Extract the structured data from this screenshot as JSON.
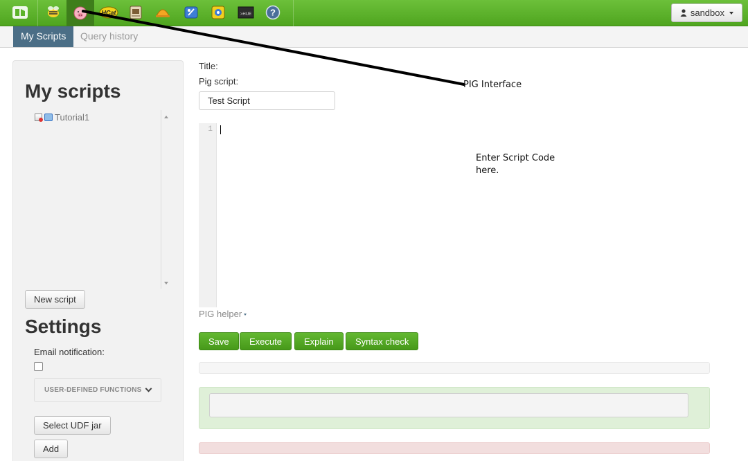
{
  "topbar": {
    "apps": [
      {
        "name": "hortonworks-logo-icon"
      },
      {
        "name": "beeswax-hive-icon"
      },
      {
        "name": "pig-icon"
      },
      {
        "name": "hcat-icon",
        "label": "HCat"
      },
      {
        "name": "file-browser-icon"
      },
      {
        "name": "job-designer-icon"
      },
      {
        "name": "oozie-editor-icon"
      },
      {
        "name": "job-browser-icon"
      },
      {
        "name": "hue-shell-icon",
        "label": "HUE"
      },
      {
        "name": "help-icon",
        "label": "?"
      }
    ],
    "user_label": "sandbox"
  },
  "subnav": {
    "tabs": [
      {
        "label": "My Scripts"
      },
      {
        "label": "Query history"
      }
    ]
  },
  "sidebar": {
    "heading": "My scripts",
    "scripts": [
      {
        "label": "Tutorial1"
      }
    ],
    "new_script_label": "New script",
    "settings_heading": "Settings",
    "email_label": "Email notification:",
    "udf_label": "USER-DEFINED FUNCTIONS",
    "select_udf_label": "Select UDF jar",
    "add_label": "Add"
  },
  "main": {
    "title_label": "Title:",
    "script_label": "Pig script:",
    "title_value": "Test Script",
    "editor_line_number": "1",
    "helper_label": "PIG helper",
    "buttons": {
      "save": "Save",
      "execute": "Execute",
      "explain": "Explain",
      "syntax": "Syntax check"
    }
  },
  "annotations": {
    "pig_interface": "PIG Interface",
    "enter_code_line1": "Enter Script Code",
    "enter_code_line2": "here."
  },
  "colors": {
    "topbar_green": "#5cb32a",
    "active_tab": "#4b6e86",
    "action_green": "#51a324"
  }
}
